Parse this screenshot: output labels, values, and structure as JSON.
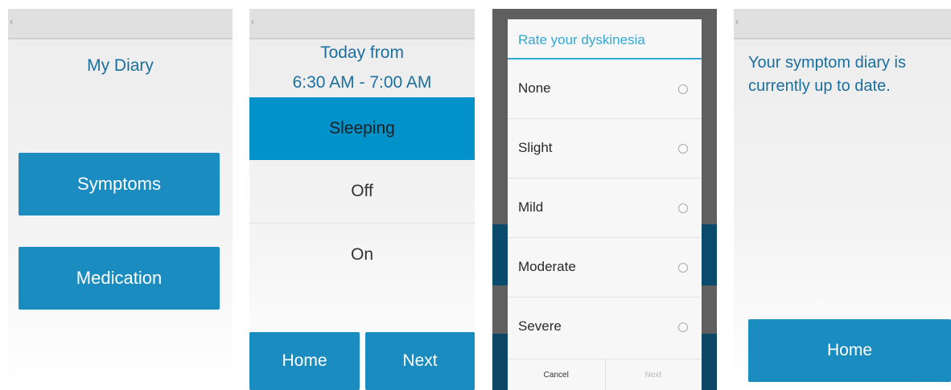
{
  "screen1": {
    "title": "My Diary",
    "symptoms_label": "Symptoms",
    "medication_label": "Medication"
  },
  "screen2": {
    "title_line1": "Today from",
    "title_line2": "6:30 AM - 7:00 AM",
    "options": [
      "Sleeping",
      "Off",
      "On"
    ],
    "selected": "Sleeping",
    "home_label": "Home",
    "next_label": "Next"
  },
  "screen3": {
    "dialog_title": "Rate your dyskinesia",
    "options": [
      "None",
      "Slight",
      "Mild",
      "Moderate",
      "Severe"
    ],
    "cancel_label": "Cancel",
    "next_label": "Next"
  },
  "screen4": {
    "message_line1": "Your symptom diary is",
    "message_line2": "currently up to date.",
    "home_label": "Home"
  },
  "colors": {
    "accent": "#1a8cc0",
    "selected": "#0092c8",
    "title_text": "#1b6f9e",
    "dialog_accent": "#31a8d8"
  },
  "icons": {
    "back": "chevron-left-icon",
    "radio": "radio-unchecked-icon"
  }
}
